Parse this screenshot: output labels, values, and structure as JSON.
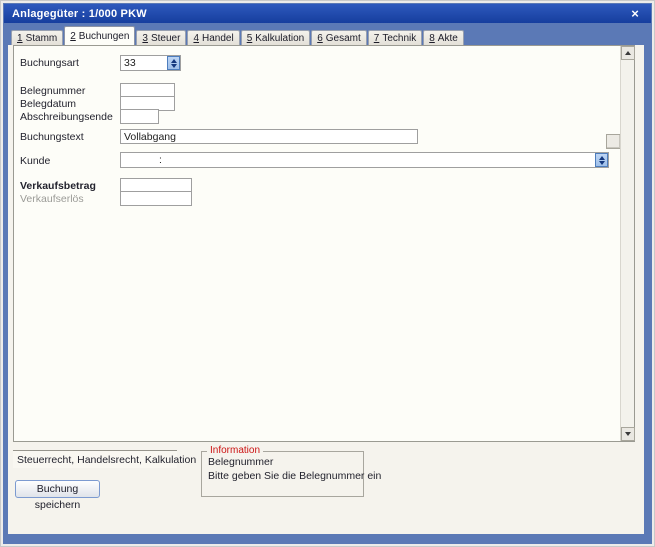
{
  "window": {
    "title": "Anlagegüter : 1/000 PKW",
    "close_glyph": "×"
  },
  "tabs": [
    {
      "key": "1",
      "label": "Stamm"
    },
    {
      "key": "2",
      "label": "Buchungen"
    },
    {
      "key": "3",
      "label": "Steuer"
    },
    {
      "key": "4",
      "label": "Handel"
    },
    {
      "key": "5",
      "label": "Kalkulation"
    },
    {
      "key": "6",
      "label": "Gesamt"
    },
    {
      "key": "7",
      "label": "Technik"
    },
    {
      "key": "8",
      "label": "Akte"
    }
  ],
  "form": {
    "buchungsart": {
      "label": "Buchungsart",
      "value": "33"
    },
    "belegnummer": {
      "label": "Belegnummer",
      "value": ""
    },
    "belegdatum": {
      "label": "Belegdatum",
      "value": ""
    },
    "abschreibungsende": {
      "label": "Abschreibungsende",
      "value": ""
    },
    "buchungstext": {
      "label": "Buchungstext",
      "value": "Vollabgang"
    },
    "kunde": {
      "label": "Kunde",
      "value": ":"
    },
    "verkaufsbetrag": {
      "label": "Verkaufsbetrag",
      "value": ""
    },
    "verkaufserloes": {
      "label": "Verkaufserlös",
      "value": ""
    }
  },
  "footer": {
    "context_text": "Steuerrecht, Handelsrecht, Kalkulation",
    "info": {
      "title": "Information",
      "line1": "Belegnummer",
      "line2": "Bitte geben Sie die Belegnummer ein"
    },
    "save_button_label": "Buchung speichern"
  },
  "colors": {
    "titlebar-top": "#2e59bd",
    "titlebar-bottom": "#163e9e",
    "frame": "#5b79b6",
    "inner-bg": "#f5f3ed",
    "panel-bg": "#fdfdf8",
    "info-title": "#cc1414",
    "spinner-border": "#4d7dbd",
    "spinner-bg": "#bdd5f4"
  }
}
